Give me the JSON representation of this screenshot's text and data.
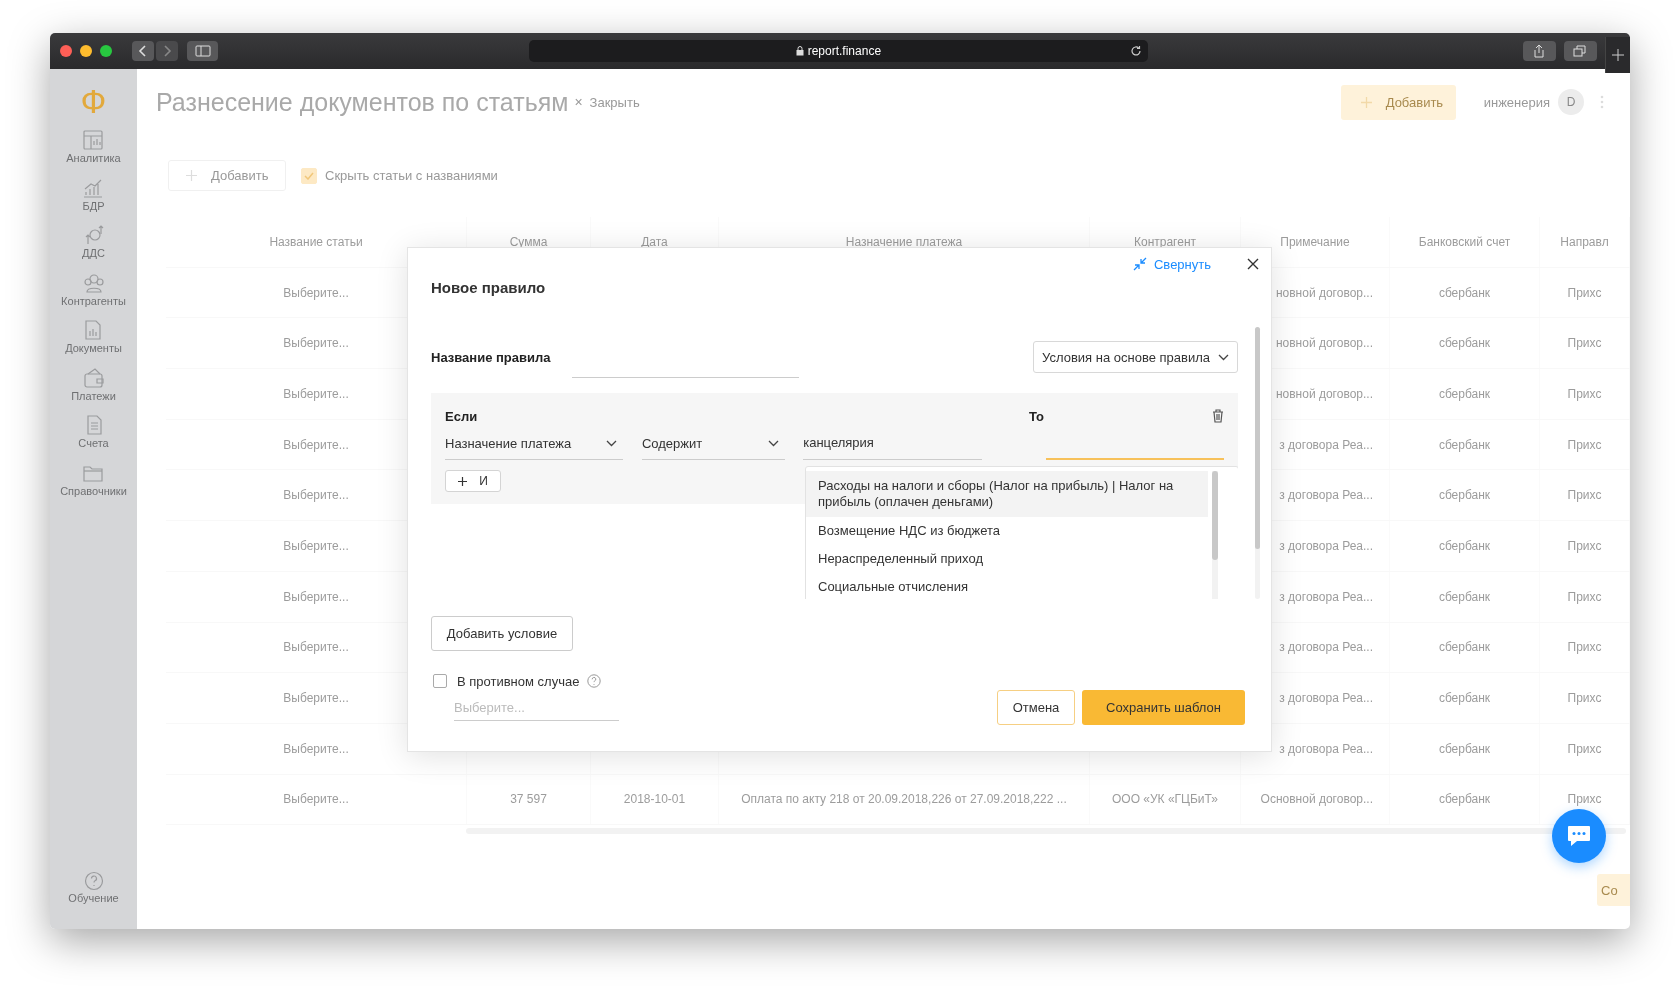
{
  "browser": {
    "url": "report.finance"
  },
  "sidebar": {
    "logo": "Ф",
    "items": [
      {
        "label": "Аналитика",
        "kind": "analytics"
      },
      {
        "label": "БДР",
        "kind": "chart"
      },
      {
        "label": "ДДС",
        "kind": "cashflow"
      },
      {
        "label": "Контрагенты",
        "kind": "contacts"
      },
      {
        "label": "Документы",
        "kind": "documents"
      },
      {
        "label": "Платежи",
        "kind": "wallet"
      },
      {
        "label": "Счета",
        "kind": "invoice"
      },
      {
        "label": "Справочники",
        "kind": "folder"
      }
    ],
    "footer": {
      "label": "Обучение",
      "kind": "help"
    }
  },
  "header": {
    "title": "Разнесение документов по статьям",
    "close_mark": "×",
    "close_label": "Закрыть",
    "add_button": "Добавить",
    "workspace": "инженерия",
    "avatar": "D"
  },
  "toolbar": {
    "add_button": "Добавить",
    "hide_checkbox": {
      "label": "Скрыть статьи с названиями",
      "checked": true
    }
  },
  "table": {
    "columns": [
      "Название статьи",
      "Сумма",
      "Дата",
      "Назначение платежа",
      "Контрагент",
      "Примечание",
      "Банковский счет",
      "Направл"
    ],
    "rows": [
      {
        "article": "Выберите...",
        "note": "новной договор...",
        "account": "сбербанк",
        "direction": "Прихс"
      },
      {
        "article": "Выберите...",
        "note": "новной договор...",
        "account": "сбербанк",
        "direction": "Прихс"
      },
      {
        "article": "Выберите...",
        "note": "новной договор...",
        "account": "сбербанк",
        "direction": "Прихс"
      },
      {
        "article": "Выберите...",
        "note": "з договора Реа...",
        "account": "сбербанк",
        "direction": "Прихс"
      },
      {
        "article": "Выберите...",
        "note": "з договора Реа...",
        "account": "сбербанк",
        "direction": "Прихс"
      },
      {
        "article": "Выберите...",
        "note": "з договора Реа...",
        "account": "сбербанк",
        "direction": "Прихс"
      },
      {
        "article": "Выберите...",
        "note": "з договора Реа...",
        "account": "сбербанк",
        "direction": "Прихс"
      },
      {
        "article": "Выберите...",
        "note": "з договора Реа...",
        "account": "сбербанк",
        "direction": "Прихс"
      },
      {
        "article": "Выберите...",
        "note": "з договора Реа...",
        "account": "сбербанк",
        "direction": "Прихс"
      },
      {
        "article": "Выберите...",
        "note": "з договора Реа...",
        "account": "сбербанк",
        "direction": "Прихс"
      },
      {
        "article": "Выберите...",
        "amount": "37 597",
        "date": "2018-10-01",
        "purpose": "Оплата по акту 218 от 20.09.2018,226 от 27.09.2018,222 ...",
        "counterparty": "ООО «УК «ГЦБиТ»",
        "note": "Основной договор...",
        "account": "сбербанк",
        "direction": "Прихс"
      }
    ]
  },
  "modal": {
    "collapse_link": "Свернуть",
    "title": "Новое правило",
    "name_label": "Название правила",
    "mode_select": "Условия на основе правила",
    "condition": {
      "if_label": "Если",
      "then_label": "То",
      "field_select": "Назначение платежа",
      "operator_select": "Содержит",
      "value": "канцелярия",
      "then_focused": true,
      "and_button": "И",
      "options": [
        {
          "label": "Расходы на налоги и сборы (Налог на прибыль) | Налог на прибыль (оплачен деньгами)",
          "selected": true
        },
        {
          "label": "Возмещение НДС из бюджета",
          "selected": false
        },
        {
          "label": "Нераспределенный приход",
          "selected": false
        },
        {
          "label": "Социальные отчисления",
          "selected": false
        }
      ]
    },
    "add_condition_button": "Добавить условие",
    "otherwise": {
      "label": "В противном случае",
      "checked": false,
      "placeholder": "Выберите..."
    },
    "cancel_button": "Отмена",
    "save_button": "Сохранить шаблон"
  },
  "bottom_button": "Со"
}
